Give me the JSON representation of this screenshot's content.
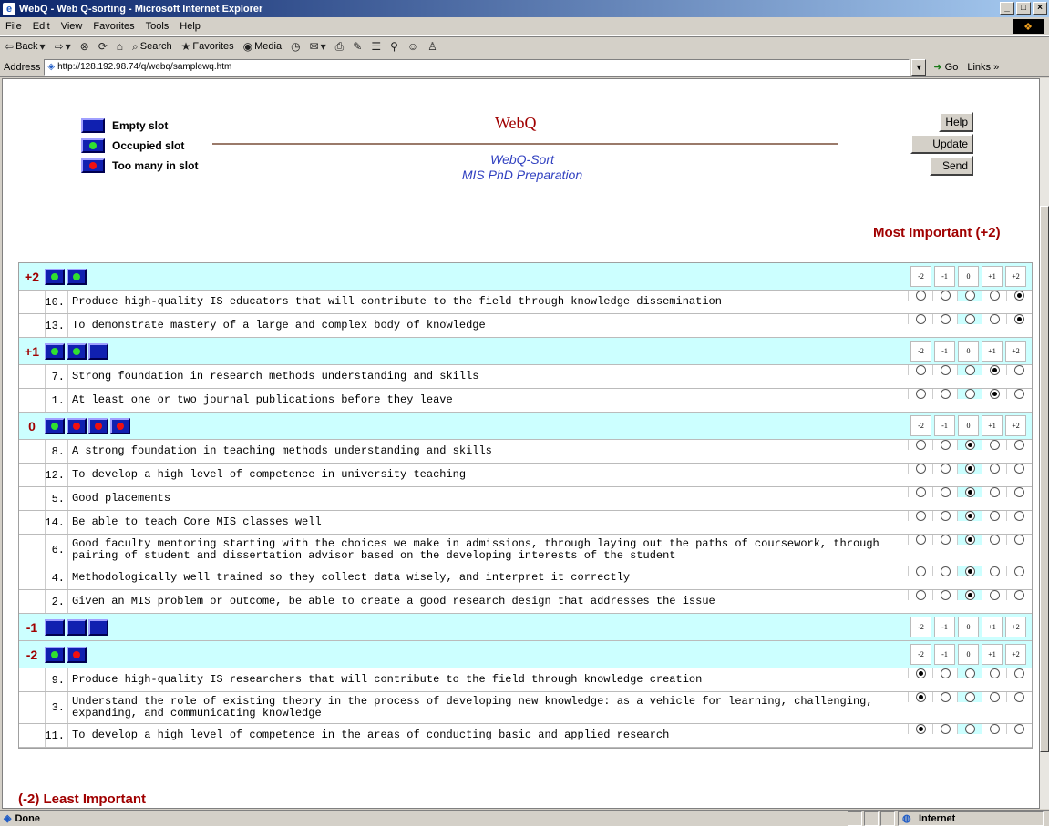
{
  "window": {
    "title": "WebQ - Web Q-sorting - Microsoft Internet Explorer"
  },
  "menu": [
    "File",
    "Edit",
    "View",
    "Favorites",
    "Tools",
    "Help"
  ],
  "toolbar": {
    "back": "Back",
    "search": "Search",
    "favorites": "Favorites",
    "media": "Media"
  },
  "address": {
    "label": "Address",
    "url": "http://128.192.98.74/q/webq/samplewq.htm",
    "go": "Go",
    "links": "Links"
  },
  "status": {
    "text": "Done",
    "zone": "Internet"
  },
  "legend": [
    {
      "label": "Empty slot",
      "state": "empty"
    },
    {
      "label": "Occupied slot",
      "state": "occupied"
    },
    {
      "label": "Too many in slot",
      "state": "over"
    }
  ],
  "header": {
    "title": "WebQ",
    "subtitle1": "WebQ-Sort",
    "subtitle2": "MIS PhD Preparation"
  },
  "buttons": {
    "help": "Help",
    "update": "Update",
    "send": "Send"
  },
  "most": "Most Important (+2)",
  "least": "(-2) Least Important",
  "scale": [
    "-2",
    "-1",
    "0",
    "+1",
    "+2"
  ],
  "groups": [
    {
      "label": "+2",
      "slots": [
        "g",
        "g"
      ],
      "items": [
        {
          "n": "10.",
          "t": "Produce high-quality IS educators that will contribute to the field through knowledge dissemination",
          "v": 4
        },
        {
          "n": "13.",
          "t": "To demonstrate mastery of a large and complex body of knowledge",
          "v": 4
        }
      ]
    },
    {
      "label": "+1",
      "slots": [
        "g",
        "g",
        "e"
      ],
      "items": [
        {
          "n": "7.",
          "t": "Strong foundation in research methods understanding and skills",
          "v": 3
        },
        {
          "n": "1.",
          "t": "At least one or two journal publications before they leave",
          "v": 3
        }
      ]
    },
    {
      "label": "0",
      "slots": [
        "g",
        "r",
        "r",
        "r"
      ],
      "items": [
        {
          "n": "8.",
          "t": "A strong foundation in teaching methods understanding and skills",
          "v": 2
        },
        {
          "n": "12.",
          "t": "To develop a high level of competence in university teaching",
          "v": 2
        },
        {
          "n": "5.",
          "t": "Good placements",
          "v": 2
        },
        {
          "n": "14.",
          "t": "Be able to teach Core MIS classes well",
          "v": 2
        },
        {
          "n": "6.",
          "t": "Good faculty mentoring starting with the choices we make in admissions, through laying out the paths of coursework, through pairing of student and dissertation advisor based on the developing interests of the student",
          "v": 2
        },
        {
          "n": "4.",
          "t": "Methodologically well trained so they collect data wisely, and interpret it correctly",
          "v": 2
        },
        {
          "n": "2.",
          "t": "Given an MIS problem or outcome, be able to create a good research design that addresses the issue",
          "v": 2
        }
      ]
    },
    {
      "label": "-1",
      "slots": [
        "e",
        "e",
        "e"
      ],
      "items": []
    },
    {
      "label": "-2",
      "slots": [
        "g",
        "r"
      ],
      "items": [
        {
          "n": "9.",
          "t": "Produce high-quality IS researchers that will contribute to the field through knowledge creation",
          "v": 0
        },
        {
          "n": "3.",
          "t": "Understand the role of existing theory in the process of developing new knowledge: as a vehicle for learning, challenging, expanding, and communicating knowledge",
          "v": 0
        },
        {
          "n": "11.",
          "t": "To develop a high level of competence in the areas of conducting basic and applied research",
          "v": 0
        }
      ]
    }
  ]
}
